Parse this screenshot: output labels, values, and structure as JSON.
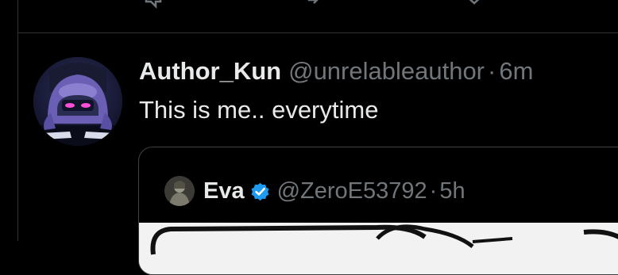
{
  "icons": {
    "top_actions": [
      "reply-icon",
      "repost-icon",
      "like-icon"
    ],
    "verified": "verified-badge-icon"
  },
  "colors": {
    "background": "#000000",
    "text_primary": "#e7e9ea",
    "text_secondary": "#71767b",
    "border": "#2f3336",
    "verified": "#1d9bf0"
  },
  "tweet": {
    "author_name": "Author_Kun",
    "author_handle": "@unrelableauthor",
    "separator": "·",
    "time": "6m",
    "text": "This is me.. everytime",
    "quote": {
      "author_name": "Eva",
      "author_handle": "@ZeroE53792",
      "separator": "·",
      "time": "5h"
    }
  }
}
